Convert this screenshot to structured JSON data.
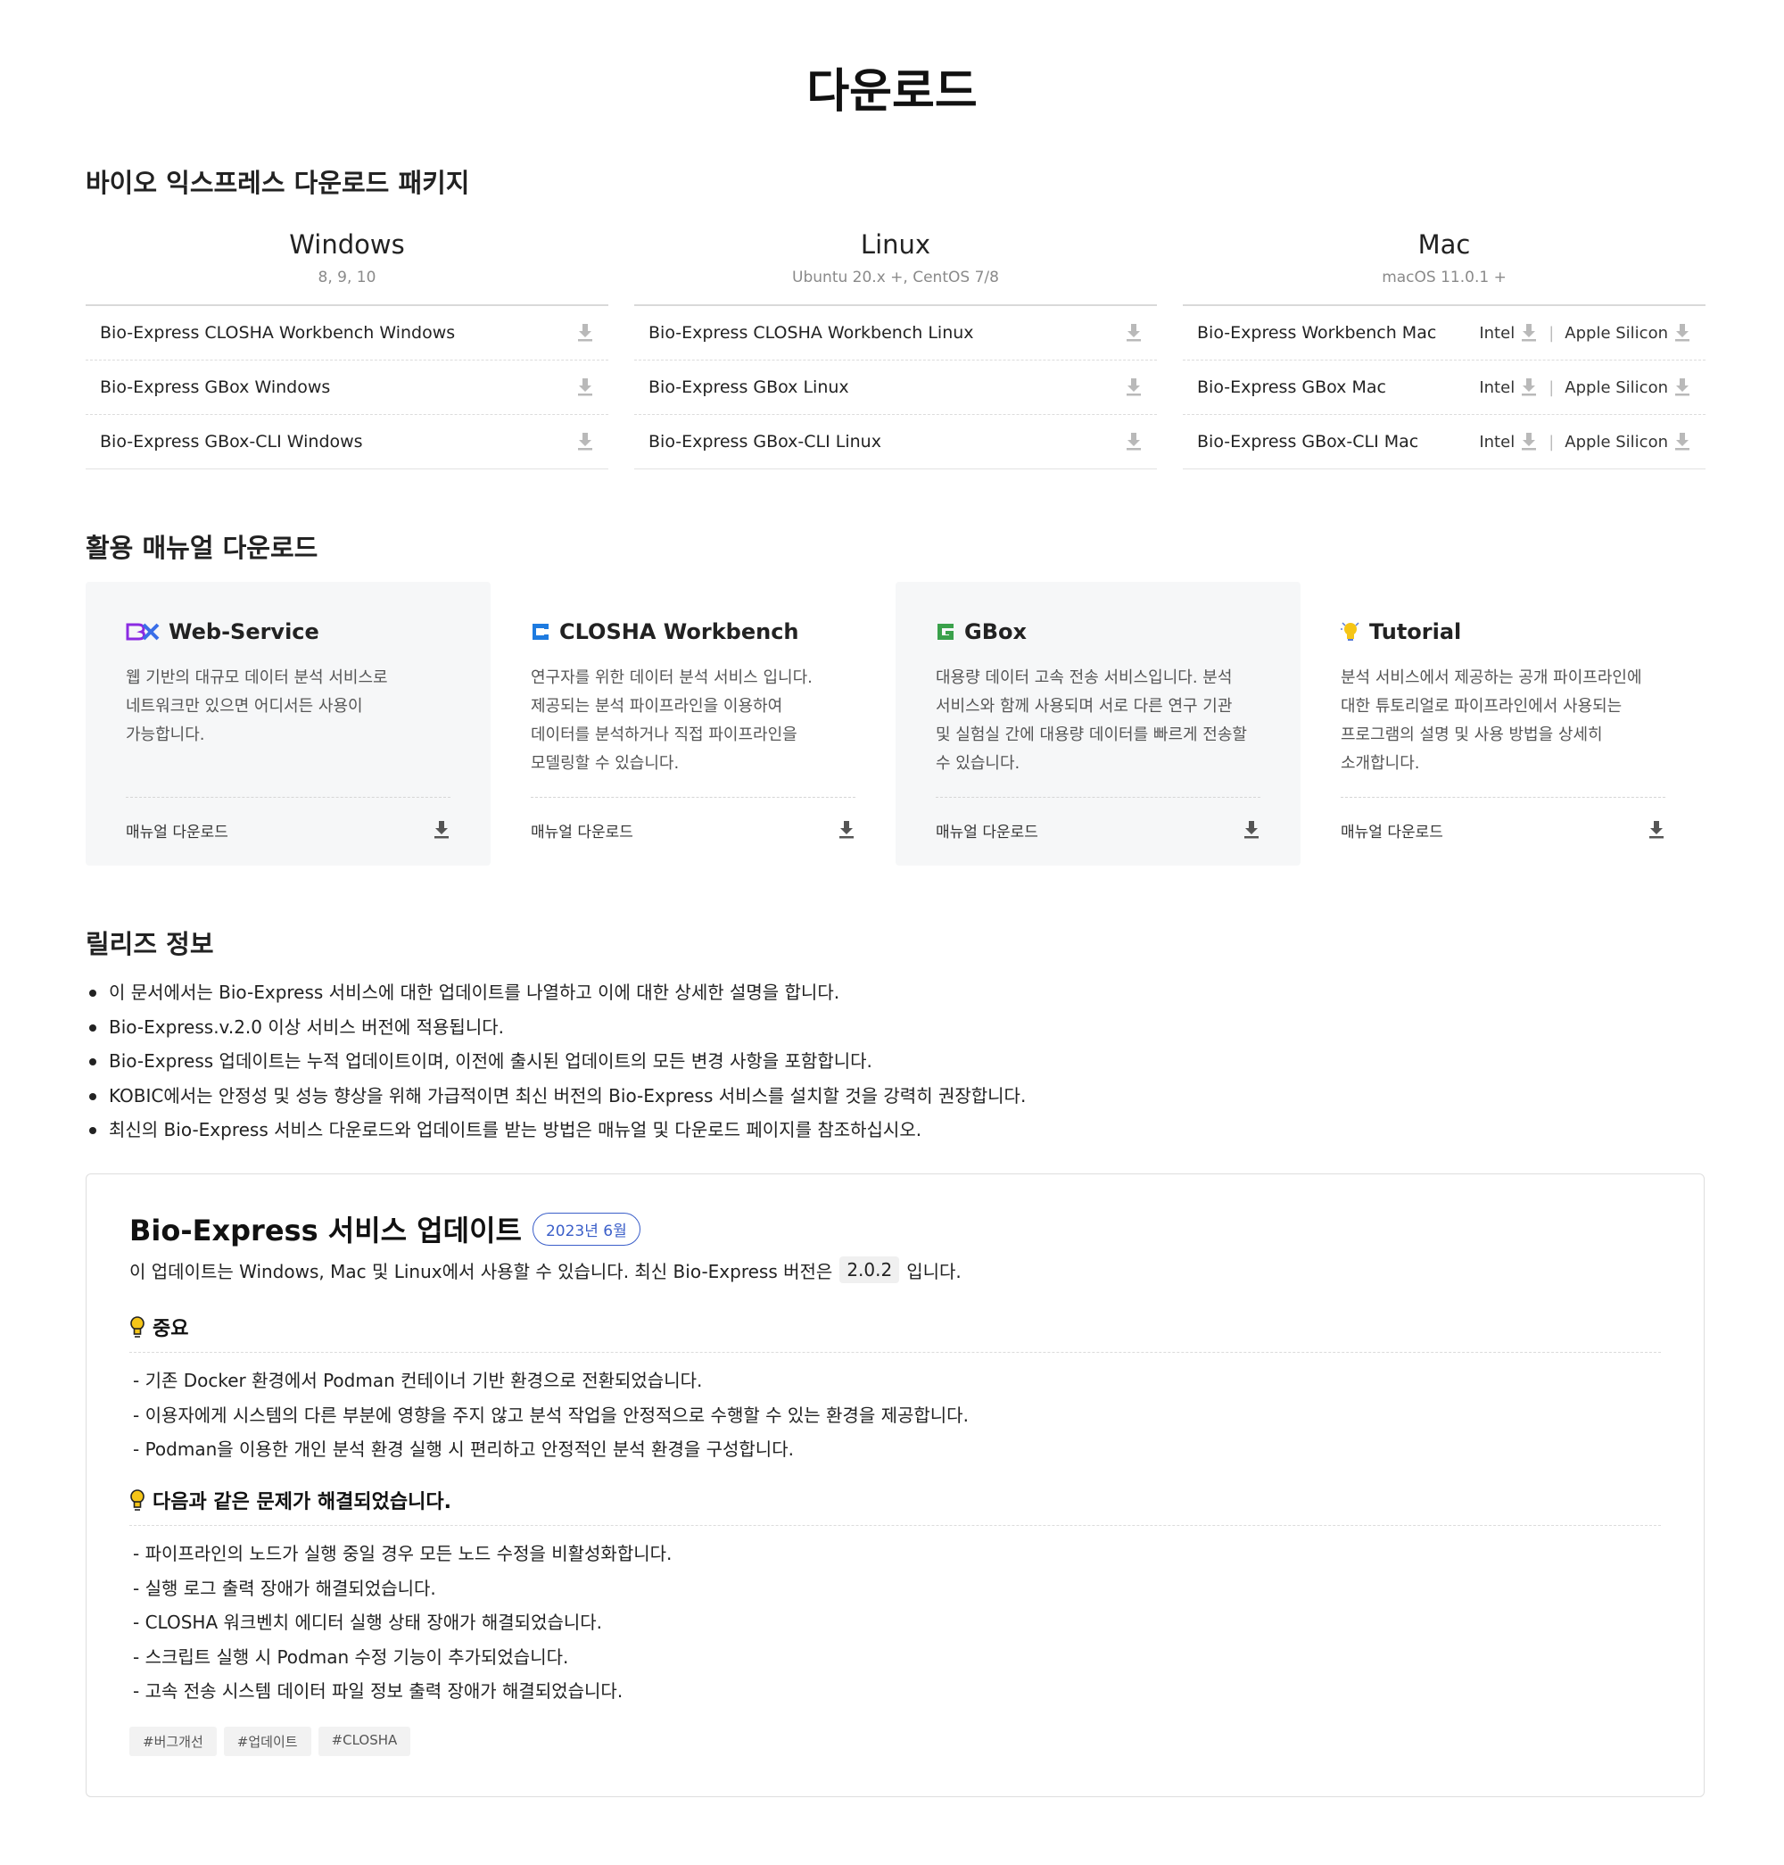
{
  "page_title": "다운로드",
  "packages": {
    "section_title": "바이오 익스프레스 다운로드 패키지",
    "windows": {
      "name": "Windows",
      "versions": "8, 9, 10",
      "items": [
        "Bio-Express CLOSHA Workbench Windows",
        "Bio-Express GBox Windows",
        "Bio-Express GBox-CLI Windows"
      ]
    },
    "linux": {
      "name": "Linux",
      "versions": "Ubuntu 20.x +, CentOS 7/8",
      "items": [
        "Bio-Express CLOSHA Workbench Linux",
        "Bio-Express GBox Linux",
        "Bio-Express GBox-CLI Linux"
      ]
    },
    "mac": {
      "name": "Mac",
      "versions": "macOS 11.0.1 +",
      "items": [
        "Bio-Express Workbench Mac",
        "Bio-Express GBox Mac",
        "Bio-Express GBox-CLI Mac"
      ],
      "intel_label": "Intel",
      "separator": "|",
      "apple_label": "Apple Silicon"
    },
    "download_icon": "download-icon"
  },
  "manuals": {
    "section_title": "활용 매뉴얼 다운로드",
    "download_label": "매뉴얼 다운로드",
    "cards": [
      {
        "icon": "bx-logo-icon",
        "title": "Web-Service",
        "description": "웹 기반의 대규모 데이터 분석 서비스로\n네트워크만 있으면 어디서든 사용이\n가능합니다."
      },
      {
        "icon": "closha-logo-icon",
        "title": "CLOSHA Workbench",
        "description": "연구자를 위한 데이터 분석 서비스 입니다.\n제공되는 분석 파이프라인을 이용하여\n데이터를 분석하거나 직접 파이프라인을\n모델링할 수 있습니다."
      },
      {
        "icon": "gbox-logo-icon",
        "title": "GBox",
        "description": "대용량 데이터 고속 전송 서비스입니다. 분석\n서비스와 함께 사용되며 서로 다른 연구 기관\n및 실험실 간에 대용량 데이터를 빠르게 전송할\n수 있습니다."
      },
      {
        "icon": "lightbulb-icon",
        "title": "Tutorial",
        "description": "분석 서비스에서 제공하는 공개 파이프라인에\n대한 튜토리얼로 파이프라인에서 사용되는\n프로그램의 설명 및 사용 방법을 상세히\n소개합니다."
      }
    ]
  },
  "release": {
    "section_title": "릴리즈 정보",
    "notes": [
      "이 문서에서는 Bio-Express 서비스에 대한 업데이트를 나열하고 이에 대한 상세한 설명을 합니다.",
      "Bio-Express.v.2.0 이상 서비스 버전에 적용됩니다.",
      "Bio-Express 업데이트는 누적 업데이트이며, 이전에 출시된 업데이트의 모든 변경 사항을 포함합니다.",
      "KOBIC에서는 안정성 및 성능 향상을 위해 가급적이면 최신 버전의 Bio-Express 서비스를 설치할 것을 강력히 권장합니다.",
      "최신의 Bio-Express 서비스 다운로드와 업데이트를 받는 방법은 매뉴얼 및 다운로드 페이지를 참조하십시오."
    ],
    "update": {
      "title": "Bio-Express 서비스 업데이트",
      "badge": "2023년 6월",
      "lead_before": "이 업데이트는 Windows, Mac 및 Linux에서 사용할 수 있습니다. 최신 Bio-Express 버전은",
      "version": "2.0.2",
      "lead_after": "입니다.",
      "important_title": "중요",
      "important_items": [
        "- 기존 Docker 환경에서 Podman 컨테이너 기반 환경으로 전환되었습니다.",
        "- 이용자에게 시스템의 다른 부분에 영향을 주지 않고 분석 작업을 안정적으로 수행할 수 있는 환경을 제공합니다.",
        "- Podman을 이용한 개인 분석 환경 실행 시 편리하고 안정적인 분석 환경을 구성합니다."
      ],
      "fixed_title": "다음과 같은 문제가 해결되었습니다.",
      "fixed_items": [
        "- 파이프라인의 노드가 실행 중일 경우 모든 노드 수정을 비활성화합니다.",
        "- 실행 로그 출력 장애가 해결되었습니다.",
        "- CLOSHA 워크벤치 에디터 실행 상태 장애가 해결되었습니다.",
        "- 스크립트 실행 시 Podman 수정 기능이 추가되었습니다.",
        "- 고속 전송 시스템 데이터 파일 정보 출력 장애가 해결되었습니다."
      ],
      "tags": [
        "#버그개선",
        "#업데이트",
        "#CLOSHA"
      ]
    }
  },
  "colors": {
    "bulb_yellow": "#f5c518",
    "bx_purple": "#8b2be2",
    "closha_blue": "#1e7be0",
    "gbox_green": "#3aa14b",
    "badge_blue": "#3b5fc9"
  }
}
